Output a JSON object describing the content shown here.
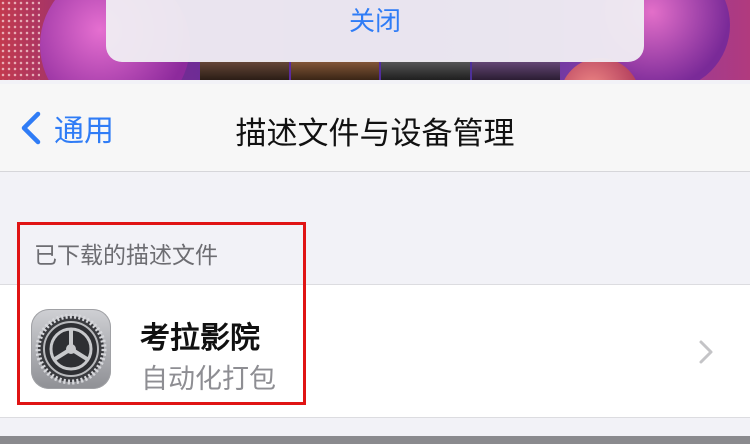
{
  "action_sheet": {
    "close_label": "关闭"
  },
  "nav": {
    "back_label": "通用",
    "title": "描述文件与设备管理"
  },
  "section": {
    "header": "已下载的描述文件"
  },
  "profile": {
    "name": "考拉影院",
    "subtitle": "自动化打包",
    "icon": "settings-gear-icon"
  },
  "colors": {
    "accent": "#2f7cf6",
    "highlight": "#e01414",
    "secondary_text": "#8e8e93"
  }
}
